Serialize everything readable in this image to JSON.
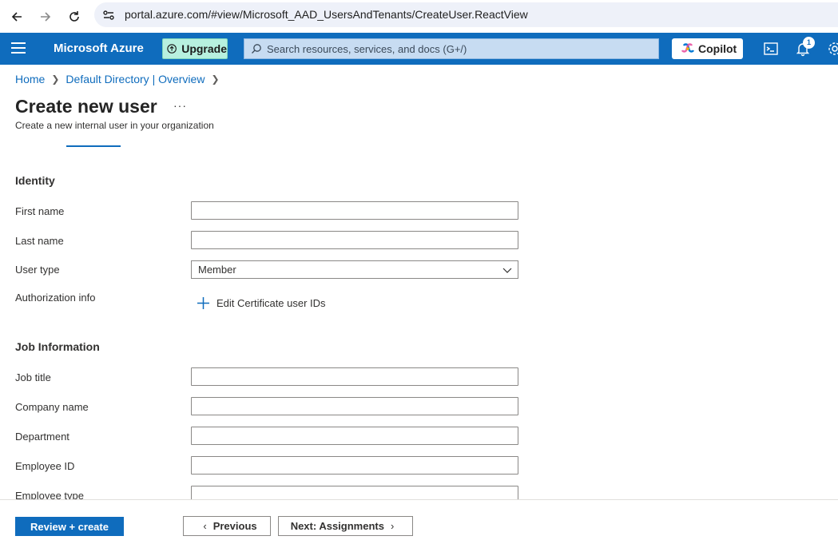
{
  "browser": {
    "url": "portal.azure.com/#view/Microsoft_AAD_UsersAndTenants/CreateUser.ReactView",
    "back_icon": "arrow-left-icon",
    "forward_icon": "arrow-right-icon",
    "reload_icon": "reload-icon",
    "site_settings_icon": "site-settings-icon"
  },
  "header": {
    "brand": "Microsoft Azure",
    "upgrade_label": "Upgrade",
    "search_placeholder": "Search resources, services, and docs (G+/)",
    "copilot_label": "Copilot",
    "notification_count": "1",
    "accent_color": "#0f6cbd"
  },
  "breadcrumb": {
    "items": [
      "Home",
      "Default Directory | Overview"
    ]
  },
  "page": {
    "title": "Create new user",
    "more": "···",
    "subtitle": "Create a new internal user in your organization"
  },
  "identity": {
    "heading": "Identity",
    "first_name_label": "First name",
    "first_name_value": "",
    "last_name_label": "Last name",
    "last_name_value": "",
    "user_type_label": "User type",
    "user_type_value": "Member",
    "authorization_label": "Authorization info",
    "edit_cert_label": "Edit Certificate user IDs"
  },
  "job": {
    "heading": "Job Information",
    "job_title_label": "Job title",
    "company_label": "Company name",
    "department_label": "Department",
    "employee_id_label": "Employee ID",
    "employee_type_label": "Employee type"
  },
  "footer": {
    "review_label": "Review + create",
    "previous_label": "Previous",
    "next_label": "Next: Assignments"
  }
}
